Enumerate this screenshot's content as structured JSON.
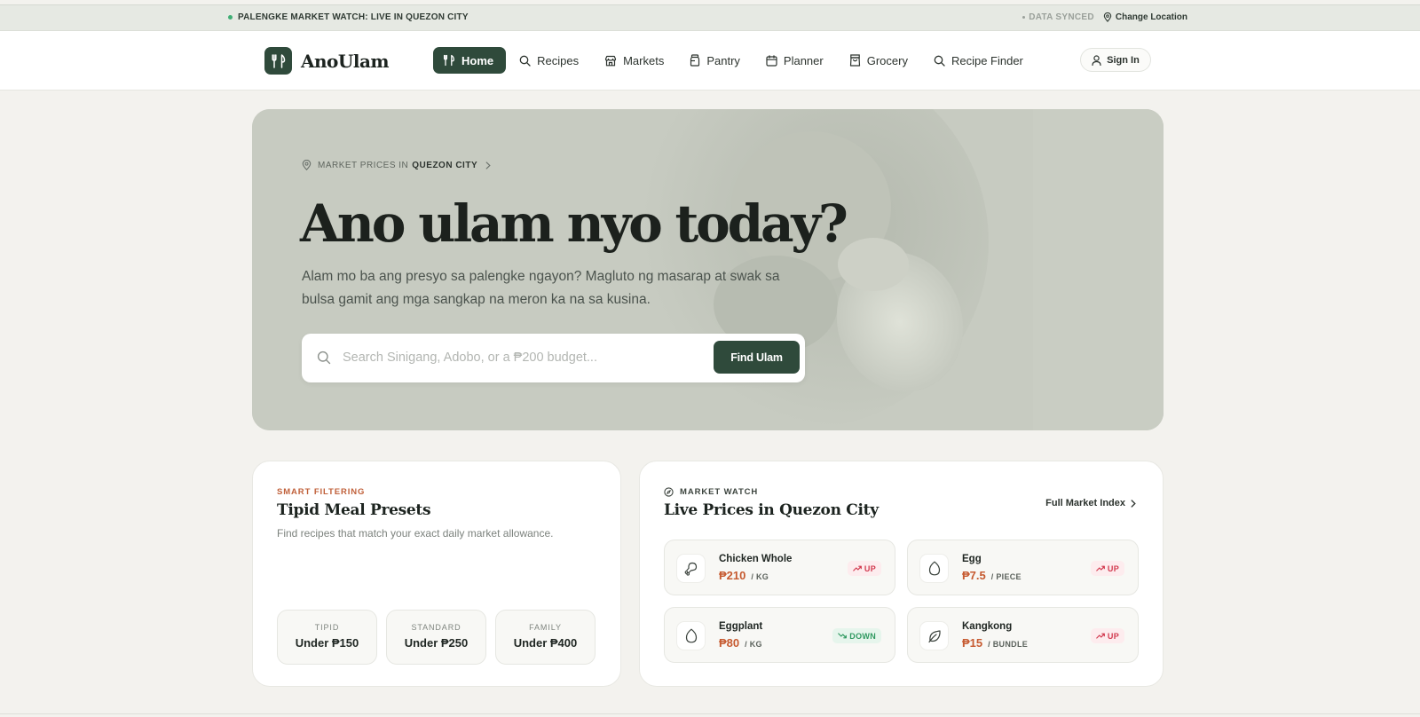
{
  "topbar": {
    "live_text": "PALENGKE MARKET WATCH: LIVE IN QUEZON CITY",
    "synced_text": "DATA SYNCED",
    "change_location": "Change Location"
  },
  "brand": {
    "name": "AnoUlam"
  },
  "nav": [
    {
      "label": "Home",
      "icon": "utensils-icon",
      "active": true
    },
    {
      "label": "Recipes",
      "icon": "search-icon"
    },
    {
      "label": "Markets",
      "icon": "store-icon"
    },
    {
      "label": "Pantry",
      "icon": "jar-icon"
    },
    {
      "label": "Planner",
      "icon": "calendar-icon"
    },
    {
      "label": "Grocery",
      "icon": "shopping-bag-icon"
    },
    {
      "label": "Recipe Finder",
      "icon": "search-icon"
    }
  ],
  "signin": {
    "label": "Sign In"
  },
  "hero": {
    "location_prefix": "MARKET PRICES IN",
    "location_city": "QUEZON CITY",
    "title": "Ano ulam nyo today?",
    "subtitle": "Alam mo ba ang presyo sa palengke ngayon? Magluto ng masarap at swak sa bulsa gamit ang mga sangkap na meron ka na sa kusina.",
    "search_placeholder": "Search Sinigang, Adobo, or a ₱200 budget...",
    "search_value": "",
    "button": "Find Ulam"
  },
  "presets_card": {
    "eyebrow": "SMART FILTERING",
    "title": "Tipid Meal Presets",
    "description": "Find recipes that match your exact daily market allowance.",
    "presets": [
      {
        "label": "TIPID",
        "value": "Under ₱150"
      },
      {
        "label": "STANDARD",
        "value": "Under ₱250"
      },
      {
        "label": "FAMILY",
        "value": "Under ₱400"
      }
    ]
  },
  "market_card": {
    "eyebrow": "MARKET WATCH",
    "title": "Live Prices in Quezon City",
    "link": "Full Market Index",
    "items": [
      {
        "name": "Chicken Whole",
        "price": "₱210",
        "unit": "/ KG",
        "trend": "UP",
        "icon": "drumstick-icon"
      },
      {
        "name": "Egg",
        "price": "₱7.5",
        "unit": "/ PIECE",
        "trend": "UP",
        "icon": "egg-icon"
      },
      {
        "name": "Eggplant",
        "price": "₱80",
        "unit": "/ KG",
        "trend": "DOWN",
        "icon": "eggplant-icon"
      },
      {
        "name": "Kangkong",
        "price": "₱15",
        "unit": "/ BUNDLE",
        "trend": "UP",
        "icon": "leaf-icon"
      }
    ]
  },
  "colors": {
    "brand_green": "#2f4a3b",
    "accent_orange": "#c65a30",
    "up_red": "#d23a4f",
    "down_green": "#2f9960"
  }
}
